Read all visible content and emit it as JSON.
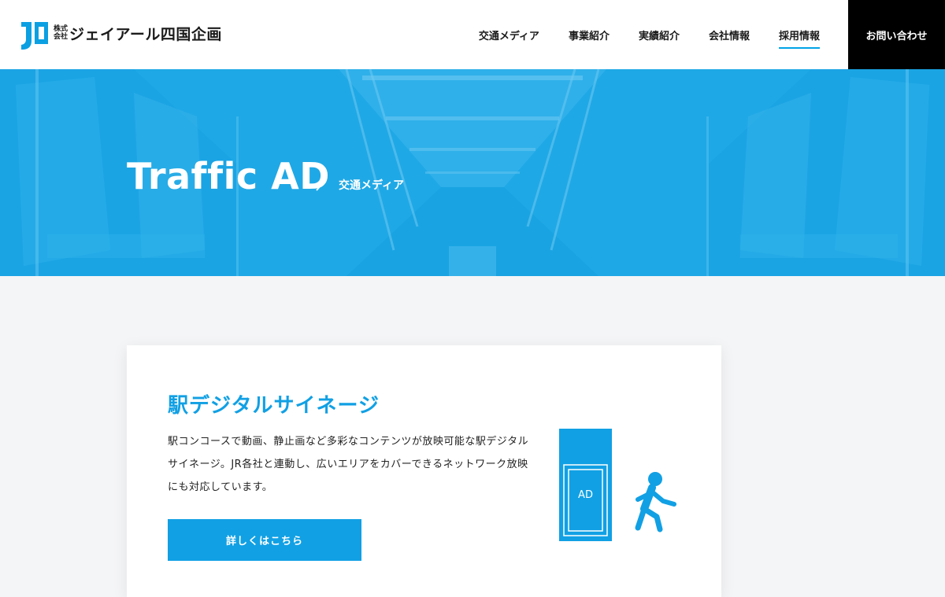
{
  "header": {
    "logo": {
      "small_line1": "株式",
      "small_line2": "会社",
      "name": "ジェイアール四国企画"
    },
    "nav": [
      {
        "label": "交通メディア",
        "active": false
      },
      {
        "label": "事業紹介",
        "active": false
      },
      {
        "label": "実績紹介",
        "active": false
      },
      {
        "label": "会社情報",
        "active": false
      },
      {
        "label": "採用情報",
        "active": true
      }
    ],
    "contact_label": "お問い合わせ"
  },
  "hero": {
    "title": "Traffic AD",
    "subtitle": "交通メディア"
  },
  "card": {
    "title": "駅デジタルサイネージ",
    "description": "駅コンコースで動画、静止画など多彩なコンテンツが放映可能な駅デジタルサイネージ。JR各社と連動し、広いエリアをカバーできるネットワーク放映にも対応しています。",
    "button_label": "詳しくはこちら",
    "illustration_text": "AD"
  },
  "colors": {
    "accent": "#11a0e4",
    "hero": "#1fa8e6",
    "contact_bg": "#000000",
    "page_bg": "#f4f5f7"
  }
}
